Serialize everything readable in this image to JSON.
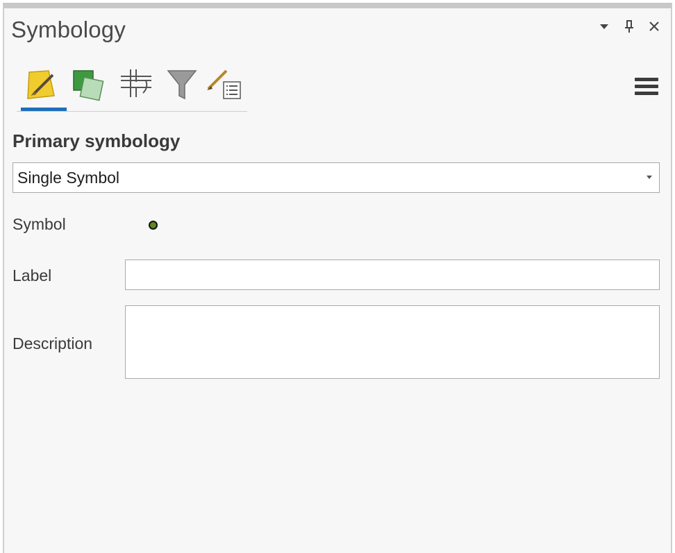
{
  "pane": {
    "title": "Symbology",
    "controls": {
      "options": "▾",
      "pin": "⊥",
      "close": "✕"
    }
  },
  "tabs": [
    {
      "icon": "primary-symbology-icon",
      "active": true
    },
    {
      "icon": "vary-symbology-icon",
      "active": false
    },
    {
      "icon": "symbol-layer-drawing-icon",
      "active": false
    },
    {
      "icon": "symbology-filter-icon",
      "active": false
    },
    {
      "icon": "symbol-properties-icon",
      "active": false
    }
  ],
  "menu_icon": "hamburger-menu-icon",
  "primary": {
    "heading": "Primary symbology",
    "selected": "Single Symbol"
  },
  "form": {
    "symbol_label": "Symbol",
    "label_label": "Label",
    "label_value": "",
    "description_label": "Description",
    "description_value": ""
  },
  "colors": {
    "accent": "#1e6fba",
    "symbol_fill": "#5c8a1f"
  }
}
